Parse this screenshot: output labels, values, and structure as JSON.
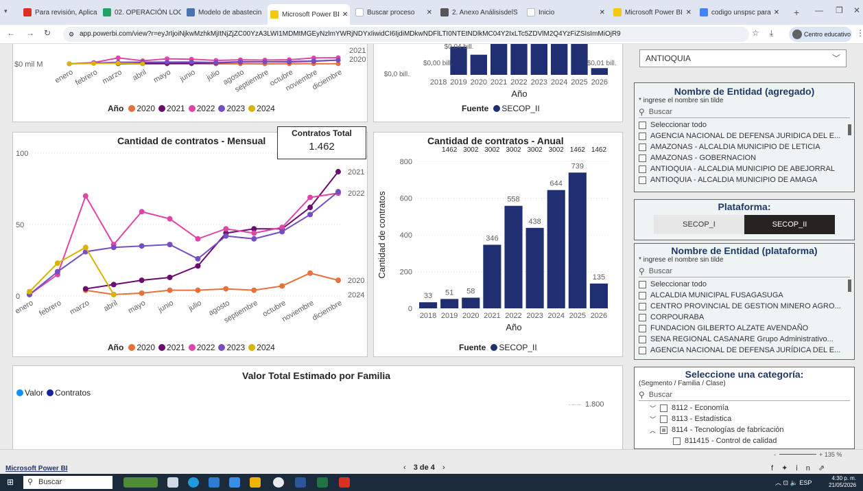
{
  "browser": {
    "tabs": [
      {
        "label": "Para revisión, Aplicac",
        "color": "#d93025"
      },
      {
        "label": "02. OPERACIÓN LOG",
        "color": "#1fa463"
      },
      {
        "label": "Modelo de abastecin",
        "color": "#4a72b0"
      },
      {
        "label": "Microsoft Power BI",
        "color": "#f2c811"
      },
      {
        "label": "Buscar proceso",
        "color": "#ffffff"
      },
      {
        "label": "2. Anexo AnálisisdelS",
        "color": "#555555"
      },
      {
        "label": "Inicio",
        "color": "#ffffff"
      },
      {
        "label": "Microsoft Power BI",
        "color": "#f2c811"
      },
      {
        "label": "codigo unspsc para",
        "color": "#4285f4"
      }
    ],
    "url": "app.powerbi.com/view?r=eyJrIjoiNjkwMzhkMjItNjZjZC00YzA3LWI1MDMtMGEyNzlmYWRjNDYxIiwidCI6IjdiMDkwNDFlLTI0NTEtNDlkMC04Y2IxLTc5ZDVlM2Q4YzFiZSIsImMiOjR9",
    "profile": "Centro educativo"
  },
  "charts": {
    "top_left": {
      "y_label": "$0 mil M",
      "month_labels": [
        "enero",
        "febrero",
        "marzo",
        "abril",
        "mayo",
        "junio",
        "julio",
        "agosto",
        "septiembre",
        "octubre",
        "noviembre",
        "diciembre"
      ],
      "end_labels": [
        "2021",
        "2020"
      ],
      "legend_title": "Año",
      "legend": [
        "2020",
        "2021",
        "2022",
        "2023",
        "2024"
      ]
    },
    "top_mid": {
      "labels": [
        "$0,04 bill.",
        "$0,00 bill.",
        "$0,0 bill.",
        "$0,01 bill."
      ],
      "x_title": "Año",
      "legend_title": "Fuente",
      "legend": [
        "SECOP_II"
      ]
    },
    "mensual": {
      "title": "Cantidad de contratos - Mensual",
      "legend_title": "Año",
      "legend": [
        "2020",
        "2021",
        "2022",
        "2023",
        "2024"
      ]
    },
    "anual": {
      "title": "Cantidad de contratos - Anual",
      "y_title": "Cantidad de contratos",
      "x_title": "Año",
      "legend_title": "Fuente",
      "legend": [
        "SECOP_II"
      ]
    },
    "familia": {
      "title": "Valor Total Estimado por Familia",
      "legend": [
        "Valor",
        "Contratos"
      ],
      "axis_label": "1.800"
    }
  },
  "kpi": {
    "label": "Contratos Total",
    "value": "1.462"
  },
  "chart_data": [
    {
      "type": "line",
      "title": "Cantidad de contratos - Mensual",
      "categories": [
        "enero",
        "febrero",
        "marzo",
        "abril",
        "mayo",
        "junio",
        "julio",
        "agosto",
        "septiembre",
        "octubre",
        "noviembre",
        "diciembre"
      ],
      "yticks": [
        "0",
        "50",
        "100"
      ],
      "ylim": [
        0,
        100
      ],
      "series": [
        {
          "name": "2020",
          "color": "#e8703a",
          "values": [
            null,
            null,
            4,
            1,
            2,
            4,
            4,
            5,
            4,
            7,
            16,
            11
          ]
        },
        {
          "name": "2021",
          "color": "#6b0a6f",
          "values": [
            null,
            null,
            5,
            8,
            11,
            13,
            21,
            44,
            47,
            47,
            62,
            87
          ]
        },
        {
          "name": "2022",
          "color": "#e044a7",
          "values": [
            1,
            15,
            70,
            36,
            59,
            54,
            40,
            47,
            44,
            48,
            69,
            72
          ]
        },
        {
          "name": "2023",
          "color": "#744ec2",
          "values": [
            1,
            17,
            31,
            34,
            35,
            36,
            26,
            42,
            40,
            45,
            57,
            73
          ]
        },
        {
          "name": "2024",
          "color": "#d9b300",
          "values": [
            3,
            23,
            34,
            1,
            null,
            null,
            null,
            null,
            null,
            null,
            null,
            null
          ]
        }
      ],
      "end_labels": [
        {
          "text": "2021",
          "value": 87
        },
        {
          "text": "2022",
          "value": 72
        },
        {
          "text": "2020",
          "value": 11
        },
        {
          "text": "2024",
          "value": 1
        }
      ]
    },
    {
      "type": "bar",
      "title": "Cantidad de contratos - Anual",
      "categories": [
        "2018",
        "2019",
        "2020",
        "2021",
        "2022",
        "2023",
        "2024",
        "2025",
        "2026"
      ],
      "values": [
        33,
        51,
        58,
        346,
        558,
        438,
        644,
        739,
        135
      ],
      "top_labels": [
        null,
        "1462",
        "3002",
        "3002",
        "3002",
        "3002",
        "3002",
        "1462",
        "1462"
      ],
      "yticks": [
        0,
        200,
        400,
        600,
        800
      ],
      "ylim": [
        0,
        800
      ],
      "xlabel": "Año",
      "ylabel": "Cantidad de contratos",
      "color": "#1f2f72"
    },
    {
      "type": "bar",
      "title": "",
      "categories": [
        "2018",
        "2019",
        "2020",
        "2021",
        "2022",
        "2023",
        "2024",
        "2025",
        "2026"
      ],
      "values": [
        0.0,
        0.042,
        0.03,
        0.055,
        0.06,
        0.06,
        0.06,
        0.06,
        0.01
      ],
      "ylim": [
        0,
        0.045
      ],
      "xlabel": "Año",
      "color": "#1f2f72"
    }
  ],
  "slicers": {
    "department": {
      "value": "ANTIOQUIA"
    },
    "entidad_agregado": {
      "title": "Nombre de Entidad (agregado)",
      "hint": "* ingrese el nombre sin tilde",
      "search": "Buscar",
      "items": [
        "Seleccionar todo",
        "AGENCIA NACIONAL DE DEFENSA JURIDICA DEL E...",
        "AMAZONAS - ALCALDIA MUNICIPIO DE LETICIA",
        "AMAZONAS - GOBERNACION",
        "ANTIOQUIA - ALCALDIA MUNICIPIO DE ABEJORRAL",
        "ANTIOQUIA - ALCALDIA MUNICIPIO DE AMAGA"
      ]
    },
    "plataforma": {
      "title": "Plataforma:",
      "options": [
        "SECOP_I",
        "SECOP_II"
      ],
      "selected": "SECOP_II"
    },
    "entidad_plataforma": {
      "title": "Nombre de Entidad (plataforma)",
      "hint": "* ingrese el nombre sin tilde",
      "search": "Buscar",
      "items": [
        "Seleccionar todo",
        "ALCALDIA MUNICIPAL FUSAGASUGA",
        "CENTRO PROVINCIAL DE GESTION MINERO AGRO...",
        "CORPOURABA",
        "FUNDACION GILBERTO ALZATE AVENDAÑO",
        "SENA REGIONAL CASANARE Grupo Administrativo...",
        "AGENCIA NACIONAL DE DEFENSA JURÍDICA DEL E..."
      ]
    },
    "categoria": {
      "title": "Seleccione una categoría:",
      "hint": "(Segmento / Familia / Clase)",
      "search": "Buscar",
      "items": [
        "8112 - Economía",
        "8113 - Estadística",
        "8114 - Tecnologías de fabricación",
        "811415 - Control de calidad"
      ]
    }
  },
  "status": {
    "link": "Microsoft Power BI",
    "page": "3 de 4",
    "zoom": "135 %"
  },
  "taskbar": {
    "search": "Buscar",
    "lang": "ESP",
    "time": "4:30 p. m.",
    "date": "21/05/2026"
  }
}
